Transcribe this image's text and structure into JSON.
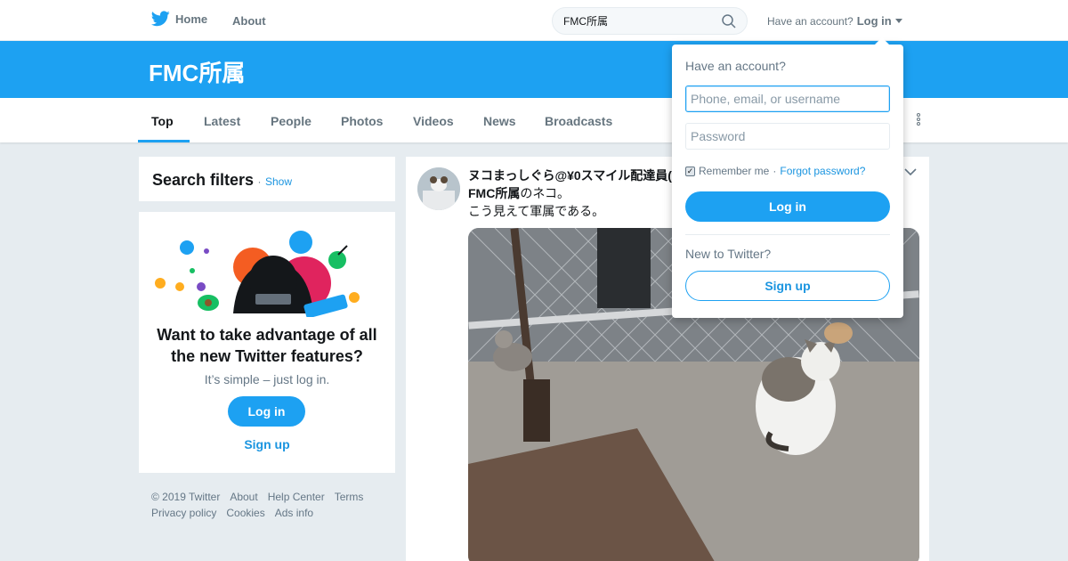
{
  "nav": {
    "home_label": "Home",
    "about_label": "About",
    "search_value": "FMC所属",
    "account_prompt": "Have an account?",
    "login_label": "Log in"
  },
  "banner": {
    "title": "FMC所属"
  },
  "tabs": [
    {
      "label": "Top",
      "active": true
    },
    {
      "label": "Latest"
    },
    {
      "label": "People"
    },
    {
      "label": "Photos"
    },
    {
      "label": "Videos"
    },
    {
      "label": "News"
    },
    {
      "label": "Broadcasts"
    }
  ],
  "filters": {
    "title": "Search filters",
    "separator": "·",
    "show_label": "Show"
  },
  "promo": {
    "heading": "Want to take advantage of all the new Twitter features?",
    "subtext": "It’s simple – just log in.",
    "login_label": "Log in",
    "signup_label": "Sign up"
  },
  "footer": {
    "links": [
      "© 2019 Twitter",
      "About",
      "Help Center",
      "Terms",
      "Privacy policy",
      "Cookies",
      "Ads info"
    ]
  },
  "tweet": {
    "author": "ヌコまっしぐら@¥0スマイル配達員(",
    "line1_bold": "FMC所属",
    "line1_rest": "のネコ。",
    "line2": "こう見えて軍属である。"
  },
  "dropdown": {
    "title": "Have an account?",
    "username_placeholder": "Phone, email, or username",
    "password_placeholder": "Password",
    "remember_label": "Remember me",
    "separator": "·",
    "forgot_label": "Forgot password?",
    "login_label": "Log in",
    "new_prompt": "New to Twitter?",
    "signup_label": "Sign up"
  },
  "colors": {
    "brand": "#1da1f2",
    "link": "#1b95e0",
    "background": "#e6ecf0"
  },
  "icons": [
    "twitter-bird-icon",
    "search-icon",
    "caret-down-icon",
    "more-dots-icon",
    "chevron-down-icon"
  ]
}
